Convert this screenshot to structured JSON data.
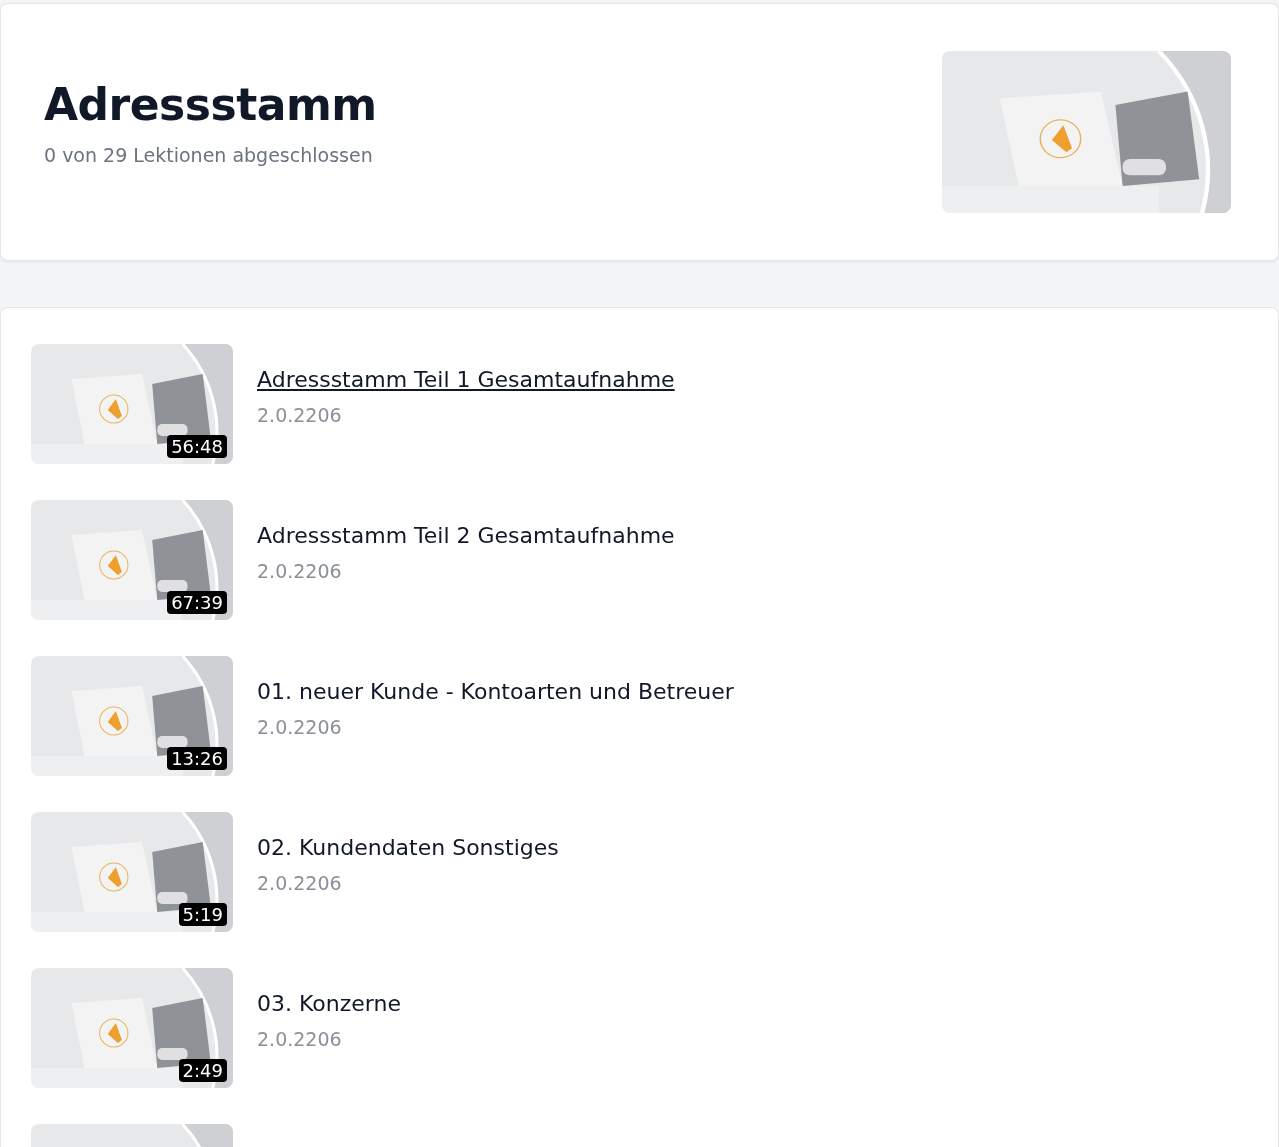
{
  "course": {
    "title": "Adressstamm",
    "progress": "0 von 29 Lektionen abgeschlossen",
    "thumbnail": {
      "kind": "picture"
    }
  },
  "lessons": [
    {
      "thumbnail": {
        "kind": "picture"
      },
      "duration": "56:48",
      "title": "Adressstamm Teil 1 Gesamtaufnahme",
      "version": "2.0.2206",
      "hovered": true
    },
    {
      "thumbnail": {
        "kind": "picture"
      },
      "duration": "67:39",
      "title": "Adressstamm Teil 2 Gesamtaufnahme",
      "version": "2.0.2206",
      "hovered": false
    },
    {
      "thumbnail": {
        "kind": "picture"
      },
      "duration": "13:26",
      "title": "01. neuer Kunde - Kontoarten und Betreuer",
      "version": "2.0.2206",
      "hovered": false
    },
    {
      "thumbnail": {
        "kind": "picture"
      },
      "duration": "5:19",
      "title": "02. Kundendaten Sonstiges",
      "version": "2.0.2206",
      "hovered": false
    },
    {
      "thumbnail": {
        "kind": "picture"
      },
      "duration": "2:49",
      "title": "03. Konzerne",
      "version": "2.0.2206",
      "hovered": false
    },
    {
      "thumbnail": {
        "kind": "picture"
      }
    }
  ]
}
